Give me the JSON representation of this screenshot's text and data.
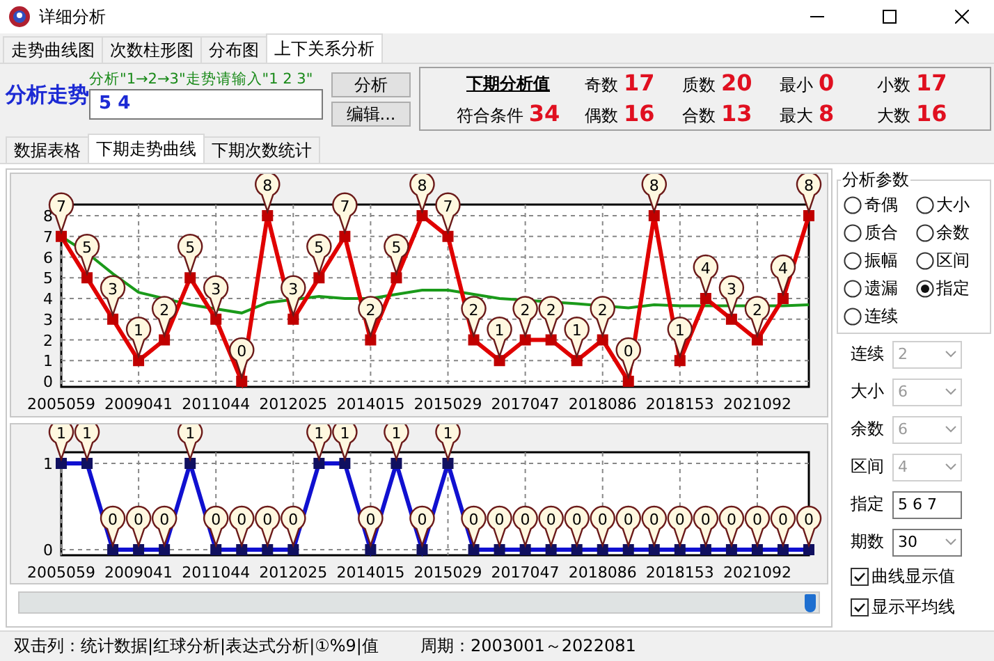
{
  "window": {
    "title": "详细分析"
  },
  "tabs": [
    {
      "label": "走势曲线图",
      "selected": false
    },
    {
      "label": "次数柱形图",
      "selected": false
    },
    {
      "label": "分布图",
      "selected": false
    },
    {
      "label": "上下关系分析",
      "selected": true
    }
  ],
  "analysis": {
    "label": "分析走势",
    "hint": "分析\"1→2→3\"走势请输入\"1 2 3\"",
    "value": "5 4",
    "buttons": [
      "分析",
      "编辑..."
    ]
  },
  "summary": {
    "title": "下期分析值",
    "match_label": "符合条件",
    "match_value": "34",
    "stats": [
      {
        "label": "奇数",
        "value": "17"
      },
      {
        "label": "偶数",
        "value": "16"
      },
      {
        "label": "质数",
        "value": "20"
      },
      {
        "label": "合数",
        "value": "13"
      },
      {
        "label": "最小",
        "value": "0"
      },
      {
        "label": "最大",
        "value": "8"
      },
      {
        "label": "小数",
        "value": "17"
      },
      {
        "label": "大数",
        "value": "16"
      }
    ]
  },
  "subtabs": [
    {
      "label": "数据表格",
      "selected": false
    },
    {
      "label": "下期走势曲线",
      "selected": true
    },
    {
      "label": "下期次数统计",
      "selected": false
    }
  ],
  "trend_chart": {
    "chart_data": {
      "type": "line",
      "categories": [
        "2005059",
        null,
        null,
        "2009041",
        null,
        null,
        "2011044",
        null,
        null,
        "2012025",
        null,
        null,
        "2014015",
        null,
        null,
        "2015029",
        null,
        null,
        "2017047",
        null,
        null,
        "2018086",
        null,
        null,
        "2018153",
        null,
        null,
        "2021092",
        null,
        null
      ],
      "yticks": [
        0,
        1,
        2,
        3,
        4,
        5,
        6,
        7,
        8
      ],
      "ylim": [
        0,
        8
      ],
      "grid": true,
      "series": [
        {
          "color": "#e00000",
          "marker": "square",
          "values": [
            7,
            5,
            3,
            1,
            2,
            5,
            3,
            0,
            8,
            3,
            5,
            7,
            2,
            5,
            8,
            7,
            2,
            1,
            2,
            2,
            1,
            2,
            0,
            8,
            1,
            4,
            3,
            2,
            4,
            8
          ],
          "value_labels": [
            "7",
            "5",
            "3",
            "1",
            "2",
            "5",
            "3",
            "0",
            "8",
            "3",
            "5",
            "7",
            "2",
            "5",
            "8",
            "7",
            "2",
            "1",
            "2",
            "2",
            "1",
            "2",
            "0",
            "8",
            "1",
            "4",
            "3",
            "2",
            "4",
            "8"
          ]
        },
        {
          "color": "#1a9a1a",
          "values": [
            7,
            6.2,
            5.2,
            4.3,
            null,
            3.7,
            null,
            3.3,
            3.8,
            null,
            4.1,
            4.0,
            4.0,
            4.2,
            4.4,
            4.4,
            4.2,
            4.0,
            null,
            null,
            3.75,
            null,
            3.55,
            3.7,
            3.65,
            3.65,
            null,
            null,
            3.65,
            3.7
          ]
        }
      ]
    }
  },
  "hit_chart": {
    "chart_data": {
      "type": "line",
      "categories": [
        "2005059",
        null,
        null,
        "2009041",
        null,
        null,
        "2011044",
        null,
        null,
        "2012025",
        null,
        null,
        "2014015",
        null,
        null,
        "2015029",
        null,
        null,
        "2017047",
        null,
        null,
        "2018086",
        null,
        null,
        "2018153",
        null,
        null,
        "2021092",
        null,
        null
      ],
      "yticks": [
        0,
        1
      ],
      "ylim": [
        0,
        1
      ],
      "grid": true,
      "series": [
        {
          "color": "#1010d0",
          "marker": "square",
          "values": [
            1,
            1,
            0,
            0,
            0,
            1,
            0,
            0,
            0,
            0,
            1,
            1,
            0,
            1,
            0,
            1,
            0,
            0,
            0,
            0,
            0,
            0,
            0,
            0,
            0,
            0,
            0,
            0,
            0,
            0
          ],
          "value_labels": [
            "1",
            "1",
            "0",
            "0",
            "0",
            "1",
            "0",
            "0",
            "0",
            "0",
            "1",
            "1",
            "0",
            "1",
            "0",
            "1",
            "0",
            "0",
            "0",
            "0",
            "0",
            "0",
            "0",
            "0",
            "0",
            "0",
            "0",
            "0",
            "0",
            "0"
          ]
        }
      ]
    }
  },
  "params": {
    "title": "分析参数",
    "options": [
      {
        "label": "奇偶",
        "selected": false
      },
      {
        "label": "大小",
        "selected": false
      },
      {
        "label": "质合",
        "selected": false
      },
      {
        "label": "余数",
        "selected": false
      },
      {
        "label": "振幅",
        "selected": false
      },
      {
        "label": "区间",
        "selected": false
      },
      {
        "label": "遗漏",
        "selected": false
      },
      {
        "label": "指定",
        "selected": true
      },
      {
        "label": "连续",
        "selected": false
      }
    ],
    "fields": [
      {
        "kind": "select",
        "label": "连续",
        "value": "2",
        "disabled": true
      },
      {
        "kind": "select",
        "label": "大小",
        "value": "6",
        "disabled": true
      },
      {
        "kind": "select",
        "label": "余数",
        "value": "6",
        "disabled": true
      },
      {
        "kind": "select",
        "label": "区间",
        "value": "4",
        "disabled": true
      },
      {
        "kind": "input",
        "label": "指定",
        "value": "5 6 7",
        "disabled": false
      },
      {
        "kind": "select",
        "label": "期数",
        "value": "30",
        "disabled": false
      }
    ],
    "checks": [
      {
        "label": "曲线显示值",
        "checked": true
      },
      {
        "label": "显示平均线",
        "checked": true
      }
    ]
  },
  "status_bar": {
    "hint": "双击列：统计数据|红球分析|表达式分析|①%9|值",
    "period": "周期：2003001～2022081"
  }
}
